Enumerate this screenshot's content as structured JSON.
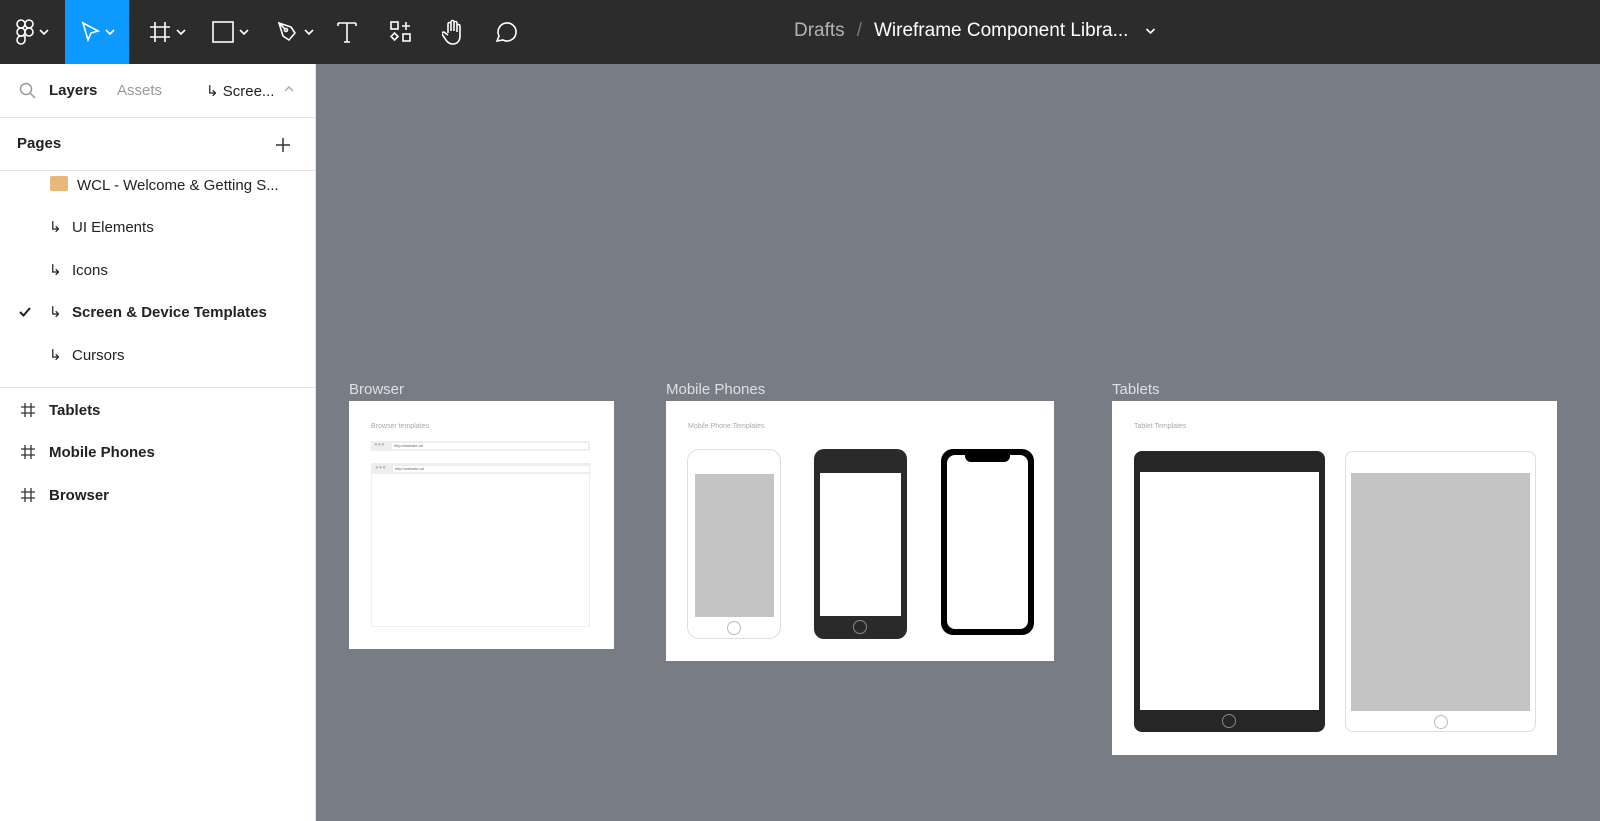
{
  "toolbar": {
    "tools": [
      "figma-menu",
      "move",
      "frame",
      "shape",
      "pen",
      "text",
      "resources",
      "hand",
      "comment"
    ],
    "active": "move",
    "accent": "#0d99ff"
  },
  "title": {
    "location": "Drafts",
    "separator": "/",
    "file": "Wireframe Component Libra..."
  },
  "sidebar": {
    "tab_layers": "Layers",
    "tab_assets": "Assets",
    "current_page": "↳ Scree...",
    "pages_heading": "Pages",
    "pages": [
      {
        "label": "WCL - Welcome & Getting S...",
        "prefix": ""
      },
      {
        "label": "UI Elements",
        "prefix": "↳"
      },
      {
        "label": "Icons",
        "prefix": "↳"
      },
      {
        "label": "Screen & Device Templates",
        "prefix": "↳",
        "selected": true
      },
      {
        "label": "Cursors",
        "prefix": "↳"
      }
    ],
    "layers": [
      "Tablets",
      "Mobile Phones",
      "Browser"
    ]
  },
  "canvas": {
    "frames": [
      {
        "name": "Browser",
        "subtitle": "Browser templates",
        "url": "http://website.url"
      },
      {
        "name": "Mobile Phones",
        "subtitle": "Mobile Phone Templates"
      },
      {
        "name": "Tablets",
        "subtitle": "Tablet Templates"
      }
    ]
  }
}
